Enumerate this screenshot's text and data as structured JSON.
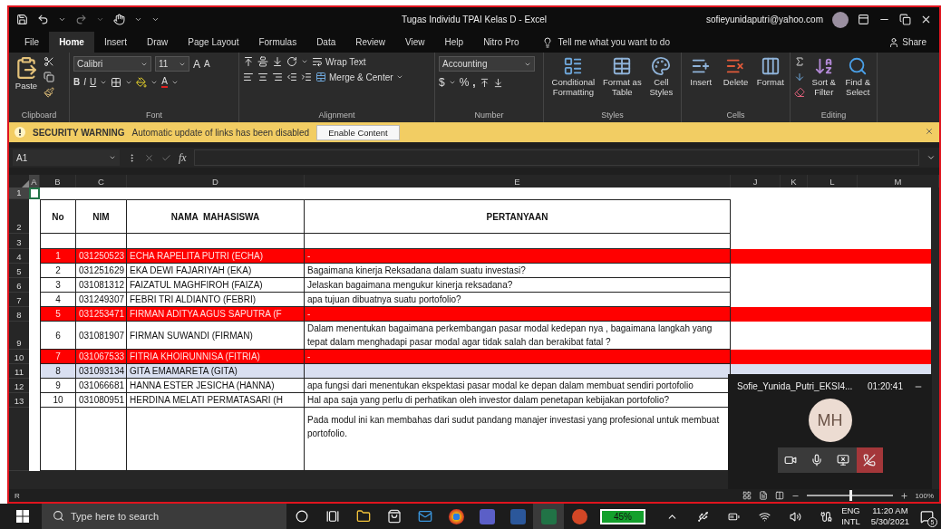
{
  "title_bar": {
    "title": "Tugas Individu TPAI Kelas D  -  Excel",
    "account": "sofieyunidaputri@yahoo.com"
  },
  "menu_tabs": [
    {
      "label": "File",
      "selected": false
    },
    {
      "label": "Home",
      "selected": true
    },
    {
      "label": "Insert",
      "selected": false
    },
    {
      "label": "Draw",
      "selected": false
    },
    {
      "label": "Page Layout",
      "selected": false
    },
    {
      "label": "Formulas",
      "selected": false
    },
    {
      "label": "Data",
      "selected": false
    },
    {
      "label": "Review",
      "selected": false
    },
    {
      "label": "View",
      "selected": false
    },
    {
      "label": "Help",
      "selected": false
    },
    {
      "label": "Nitro Pro",
      "selected": false
    }
  ],
  "tell_me": "Tell me what you want to do",
  "share": "Share",
  "ribbon": {
    "clipboard": {
      "paste": "Paste",
      "label": "Clipboard"
    },
    "font": {
      "name": "Calibri",
      "size": "11",
      "grow": "A",
      "shrink": "A",
      "bold": "B",
      "italic": "I",
      "underline": "U",
      "font_color": "A",
      "label": "Font"
    },
    "alignment": {
      "wrap": "Wrap Text",
      "merge": "Merge & Center",
      "label": "Alignment"
    },
    "number": {
      "format": "Accounting",
      "currency": "$",
      "percent": "%",
      "comma": ",",
      "label": "Number"
    },
    "styles": {
      "buttons": [
        "Conditional Formatting",
        "Format as Table",
        "Cell Styles"
      ],
      "label": "Styles"
    },
    "cells": {
      "buttons": [
        "Insert",
        "Delete",
        "Format"
      ],
      "label": "Cells"
    },
    "editing": {
      "buttons": [
        "Sort & Filter",
        "Find & Select"
      ],
      "label": "Editing"
    }
  },
  "security_bar": {
    "title": "SECURITY WARNING",
    "message": "Automatic update of links has been disabled",
    "button": "Enable Content"
  },
  "formula_bar": {
    "name_box": "A1",
    "function_label": "fx"
  },
  "columns": [
    "A",
    "B",
    "C",
    "D",
    "E",
    "J",
    "K",
    "L",
    "M"
  ],
  "header_rows": [
    "1",
    "2",
    "3"
  ],
  "table_header": {
    "no": "No",
    "nim": "NIM",
    "name": "NAMA  MAHASISWA",
    "question": "PERTANYAAN"
  },
  "rows": [
    {
      "row": "4",
      "no": "1",
      "nim": "031250523",
      "name": "ECHA RAPELITA PUTRI (ECHA)",
      "question": "-",
      "kind": "flagged"
    },
    {
      "row": "5",
      "no": "2",
      "nim": "031251629",
      "name": "EKA DEWI FAJARIYAH (EKA)",
      "question": "Bagaimana kinerja Reksadana dalam suatu investasi?",
      "kind": "normal"
    },
    {
      "row": "6",
      "no": "3",
      "nim": "031081312",
      "name": "FAIZATUL MAGHFIROH (FAIZA)",
      "question": "Jelaskan bagaimana mengukur kinerja reksadana?",
      "kind": "normal"
    },
    {
      "row": "7",
      "no": "4",
      "nim": "031249307",
      "name": "FEBRI TRI ALDIANTO (FEBRI)",
      "question": "apa tujuan dibuatnya suatu portofolio?",
      "kind": "normal"
    },
    {
      "row": "8",
      "no": "5",
      "nim": "031253471",
      "name": "FIRMAN ADITYA AGUS SAPUTRA (F",
      "question": "-",
      "kind": "flagged"
    },
    {
      "row": "9",
      "no": "6",
      "nim": "031081907",
      "name": "FIRMAN SUWANDI (FIRMAN)",
      "question": "Dalam menentukan bagaimana perkembangan pasar modal kedepan nya , bagaimana langkah yang tepat dalam menghadapi pasar modal agar tidak salah dan berakibat fatal ?",
      "kind": "normal"
    },
    {
      "row": "10",
      "no": "7",
      "nim": "031067533",
      "name": "FITRIA KHOIRUNNISA (FITRIA)",
      "question": "-",
      "kind": "flagged"
    },
    {
      "row": "11",
      "no": "8",
      "nim": "031093134",
      "name": "GITA EMAMARETA (GITA)",
      "kind": "selected"
    },
    {
      "row": "12",
      "no": "9",
      "nim": "031066681",
      "name": "HANNA ESTER JESICHA (HANNA)",
      "question": "apa fungsi dari menentukan ekspektasi pasar modal ke depan dalam membuat sendiri portofolio",
      "kind": "normal"
    },
    {
      "row": "13",
      "no": "10",
      "nim": "031080951",
      "name": "HERDINA MELATI PERMATASARI (H",
      "question": "Hal apa saja yang perlu di perhatikan oleh investor dalam penetapan kebijakan portofolio?",
      "kind": "normal"
    },
    {
      "question": "Pada modul ini kan membahas dari sudut pandang manajer investasi yang profesional untuk membuat portofolio.",
      "kind": "normal"
    }
  ],
  "status_bar": {
    "mode": "R",
    "zoom": {
      "level": 0.5,
      "reading": "100%"
    }
  },
  "call_window": {
    "name": "Sofie_Yunida_Putri_EKSI4...",
    "time": "01:20:41",
    "initials": "MH"
  },
  "taskbar": {
    "search_placeholder": "Type here to search",
    "battery": "45%",
    "language": "ENG",
    "layout": "INTL",
    "time": "11:20 AM",
    "date": "5/30/2021",
    "notifications": "5"
  }
}
